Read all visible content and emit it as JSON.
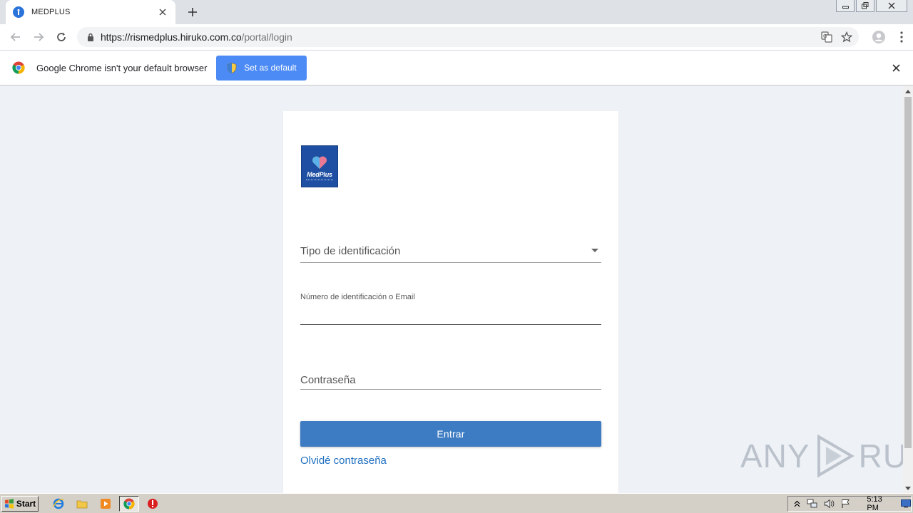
{
  "browser": {
    "tab_title": "MEDPLUS",
    "url_host": "https://rismedplus.hiruko.com.co",
    "url_path": "/portal/login"
  },
  "infobar": {
    "message": "Google Chrome isn't your default browser",
    "button_label": "Set as default"
  },
  "login": {
    "logo_text": "MedPlus",
    "id_type_label": "Tipo de identificación",
    "id_label": "Número de identificación o Email",
    "id_value": "",
    "password_placeholder": "Contraseña",
    "submit_label": "Entrar",
    "forgot_label": "Olvidé contraseña"
  },
  "watermark": {
    "left": "ANY",
    "right": "RUN"
  },
  "taskbar": {
    "start_label": "Start",
    "clock": "5:13 PM"
  },
  "colors": {
    "primary_button": "#3d7cc3",
    "link": "#1f6fc0",
    "infobar_button": "#4c8bf5",
    "logo_bg": "#1e4fa2",
    "page_bg": "#eef2f6"
  }
}
